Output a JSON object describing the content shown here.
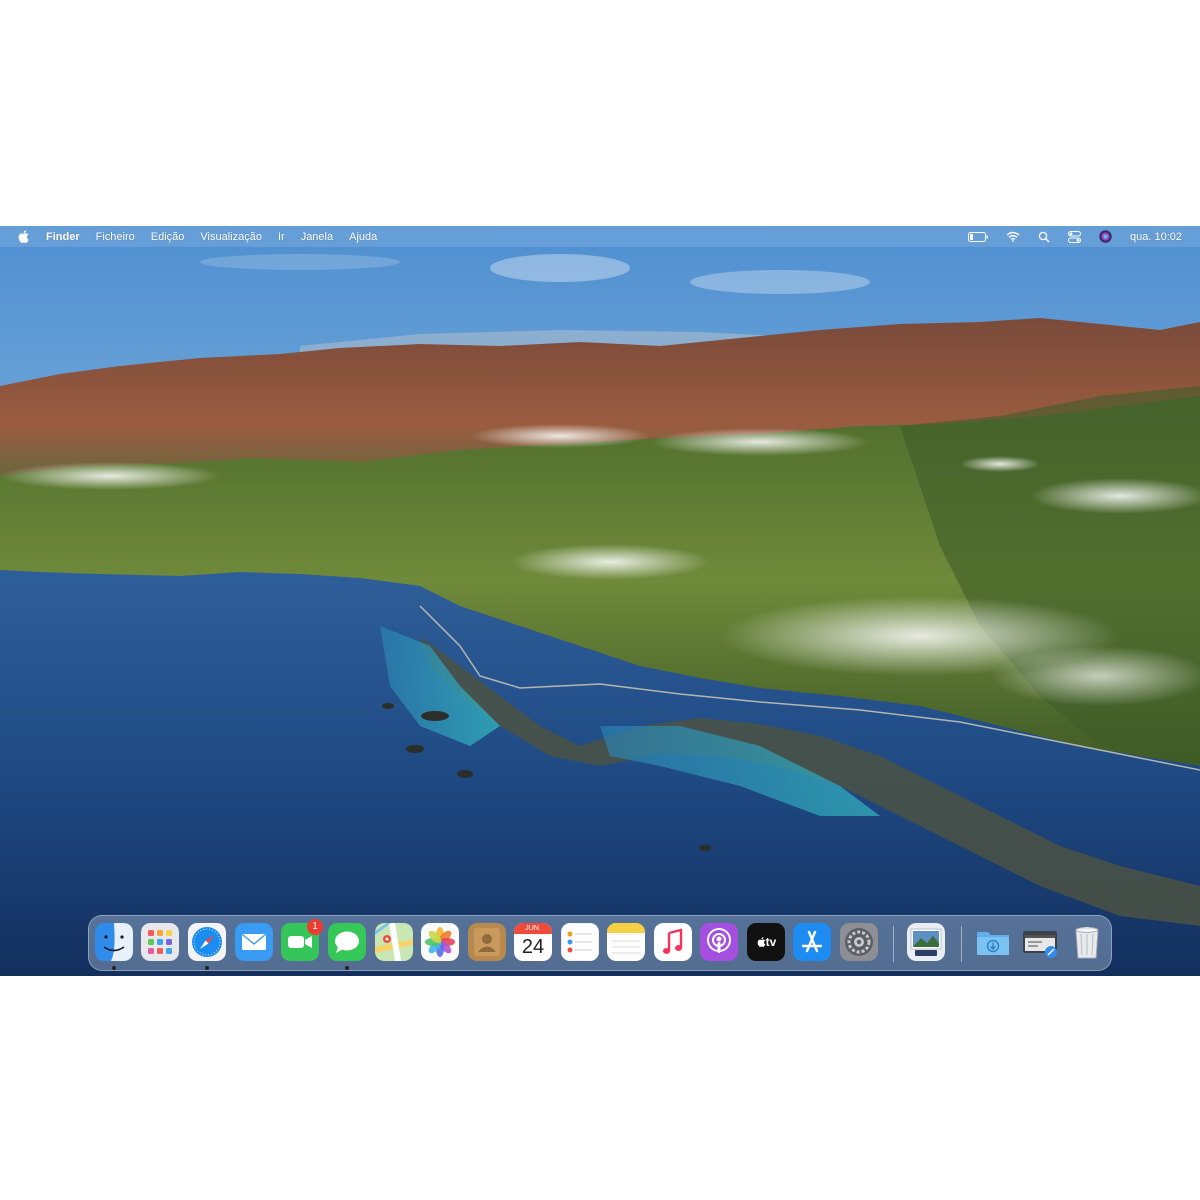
{
  "menubar": {
    "app_name": "Finder",
    "items": [
      "Ficheiro",
      "Edição",
      "Visualização",
      "Ir",
      "Janela",
      "Ajuda"
    ],
    "status_icons": [
      "battery-icon",
      "wifi-icon",
      "search-icon",
      "control-center-icon",
      "siri-icon"
    ],
    "clock": "qua. 10:02"
  },
  "dock": {
    "apps": [
      {
        "name": "Finder",
        "icon": "finder-icon",
        "running": true
      },
      {
        "name": "Launchpad",
        "icon": "launchpad-icon",
        "running": false
      },
      {
        "name": "Safari",
        "icon": "safari-icon",
        "running": true
      },
      {
        "name": "Mail",
        "icon": "mail-icon",
        "running": false
      },
      {
        "name": "FaceTime",
        "icon": "facetime-icon",
        "running": false,
        "badge": "1"
      },
      {
        "name": "Messages",
        "icon": "messages-icon",
        "running": true
      },
      {
        "name": "Maps",
        "icon": "maps-icon",
        "running": false
      },
      {
        "name": "Photos",
        "icon": "photos-icon",
        "running": false
      },
      {
        "name": "Contacts",
        "icon": "contacts-icon",
        "running": false
      },
      {
        "name": "Calendar",
        "icon": "calendar-icon",
        "running": false,
        "month": "JUN.",
        "day": "24"
      },
      {
        "name": "Reminders",
        "icon": "reminders-icon",
        "running": false
      },
      {
        "name": "Notes",
        "icon": "notes-icon",
        "running": false
      },
      {
        "name": "Music",
        "icon": "music-icon",
        "running": false
      },
      {
        "name": "Podcasts",
        "icon": "podcasts-icon",
        "running": false
      },
      {
        "name": "TV",
        "icon": "apple-tv-icon",
        "running": false,
        "label": "tv"
      },
      {
        "name": "App Store",
        "icon": "app-store-icon",
        "running": false
      },
      {
        "name": "System Preferences",
        "icon": "system-preferences-icon",
        "running": false
      },
      {
        "name": "Preview",
        "icon": "preview-icon",
        "running": false
      },
      {
        "name": "Downloads",
        "icon": "downloads-folder-icon",
        "running": false
      },
      {
        "name": "Screen Sharing",
        "icon": "screen-sharing-icon",
        "running": false
      },
      {
        "name": "Trash",
        "icon": "trash-icon",
        "running": false
      }
    ]
  },
  "colors": {
    "sky": "#6fa7d6",
    "ocean": "#1d4a86",
    "lagoon": "#2aa8b8",
    "mountains_far": "#8a5a44",
    "mountains_near": "#5f7a34",
    "badge": "#ee3b30"
  }
}
